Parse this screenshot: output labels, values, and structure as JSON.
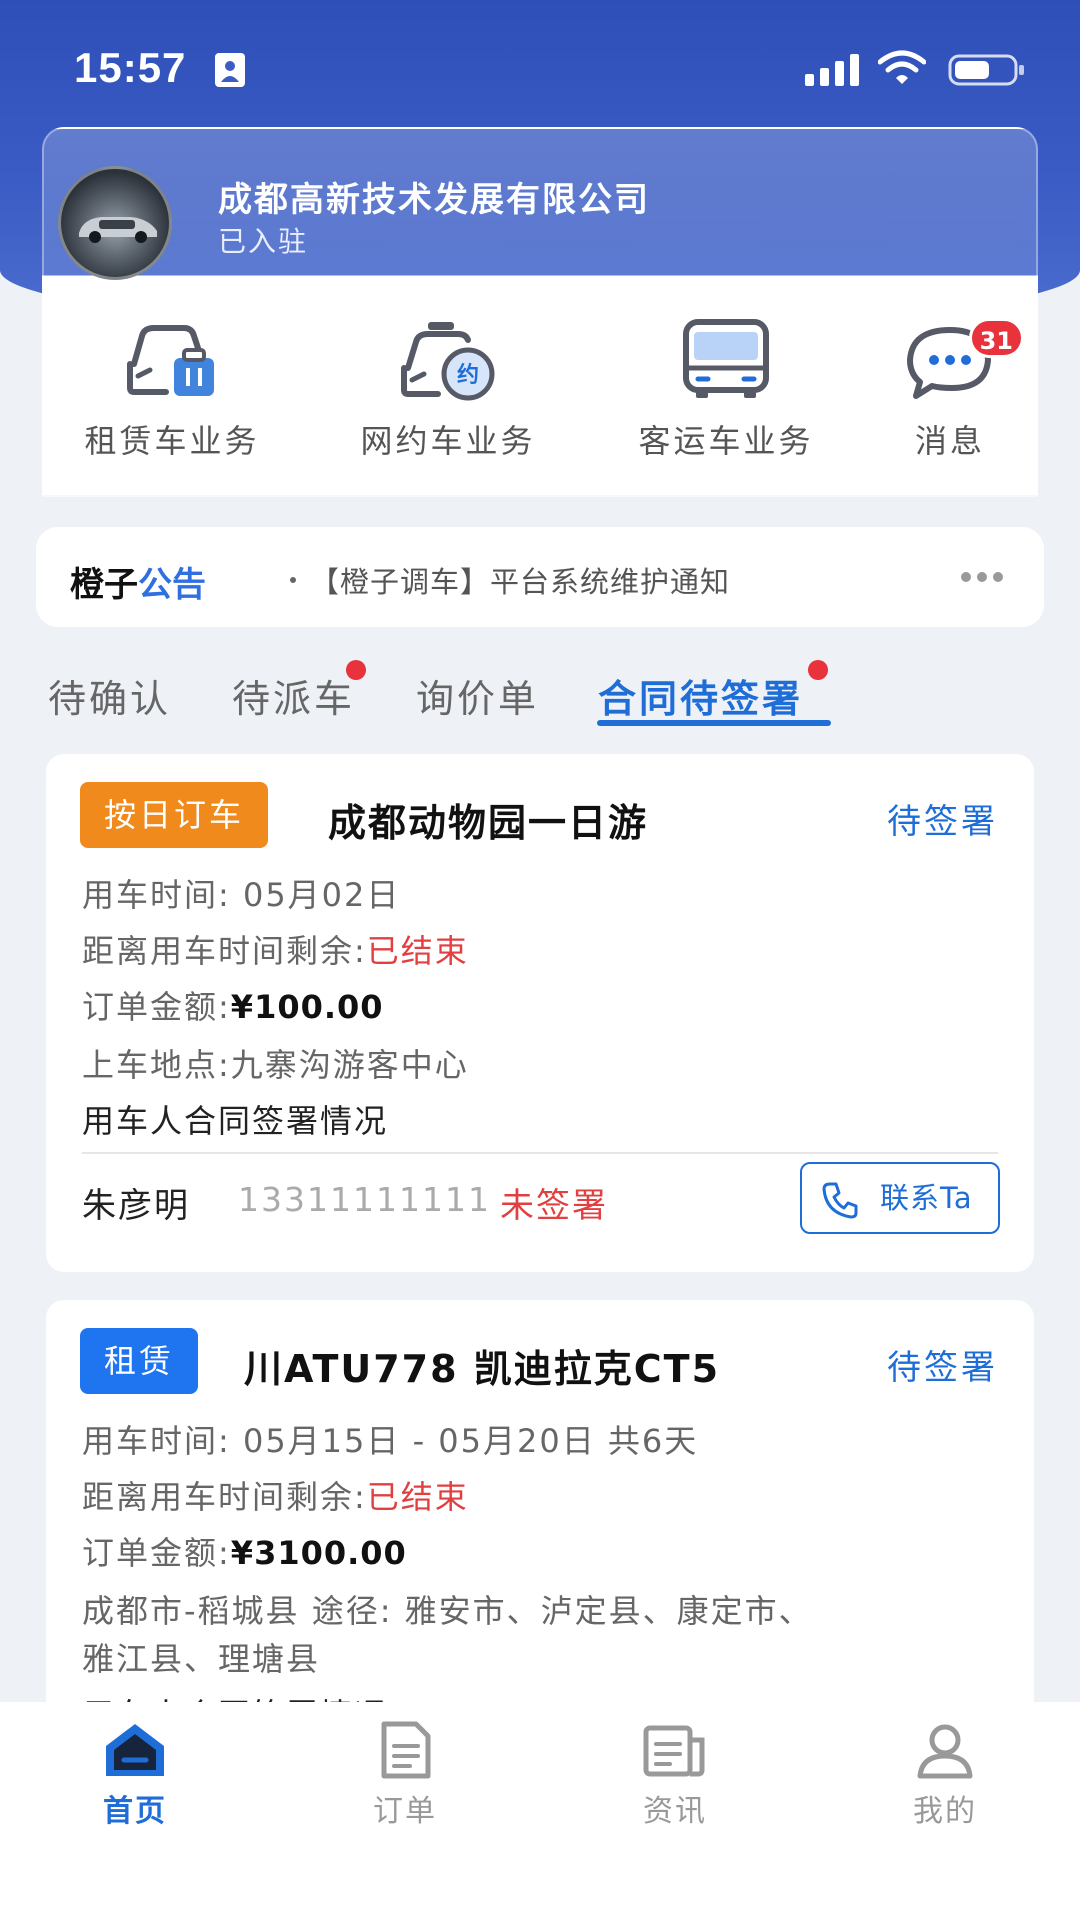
{
  "status_bar": {
    "time": "15:57"
  },
  "company": {
    "name": "成都高新技术发展有限公司",
    "status": "已入驻"
  },
  "services": [
    {
      "label": "租赁车业务",
      "icon": "rental-car-icon"
    },
    {
      "label": "网约车业务",
      "icon": "ride-hailing-car-icon"
    },
    {
      "label": "客运车业务",
      "icon": "bus-icon"
    },
    {
      "label": "消息",
      "icon": "message-icon",
      "badge": "31"
    }
  ],
  "notice": {
    "brand": "橙子",
    "brand_accent": "公告",
    "text": "【橙子调车】平台系统维护通知"
  },
  "tabs": [
    {
      "label": "待确认",
      "dot": false
    },
    {
      "label": "待派车",
      "dot": true
    },
    {
      "label": "询价单",
      "dot": false
    },
    {
      "label": "合同待签署",
      "dot": true,
      "active": true
    }
  ],
  "orders": [
    {
      "tag": "按日订车",
      "title": "成都动物园一日游",
      "status": "待签署",
      "time": "用车时间: 05月02日",
      "remaining_label": "距离用车时间剩余:",
      "remaining_value": "已结束",
      "amount_label": "订单金额:",
      "amount_value": "¥100.00",
      "pickup": "上车地点:九寨沟游客中心",
      "sign_heading": "用车人合同签署情况",
      "signer": {
        "name": "朱彦明",
        "phone": "13311111111",
        "state": "未签署"
      },
      "contact_label": "联系Ta"
    },
    {
      "tag": "租赁",
      "title": "川ATU778 凯迪拉克CT5",
      "status": "待签署",
      "time": "用车时间: 05月15日  - 05月20日 共6天",
      "remaining_label": "距离用车时间剩余:",
      "remaining_value": "已结束",
      "amount_label": "订单金额:",
      "amount_value": "¥3100.00",
      "route_line1": "成都市-稻城县 途径: 雅安市、泸定县、康定市、",
      "route_line2": "雅江县、理塘县",
      "sign_heading": "用车人合同签署情况"
    }
  ],
  "bottom_nav": [
    {
      "label": "首页",
      "icon": "home-icon",
      "active": true
    },
    {
      "label": "订单",
      "icon": "order-document-icon"
    },
    {
      "label": "资讯",
      "icon": "news-icon"
    },
    {
      "label": "我的",
      "icon": "profile-icon"
    }
  ],
  "colors": {
    "primary": "#1f6ed8",
    "header": "#3a5cc4",
    "orange_tag": "#f08a1c",
    "alert": "#e24040"
  }
}
